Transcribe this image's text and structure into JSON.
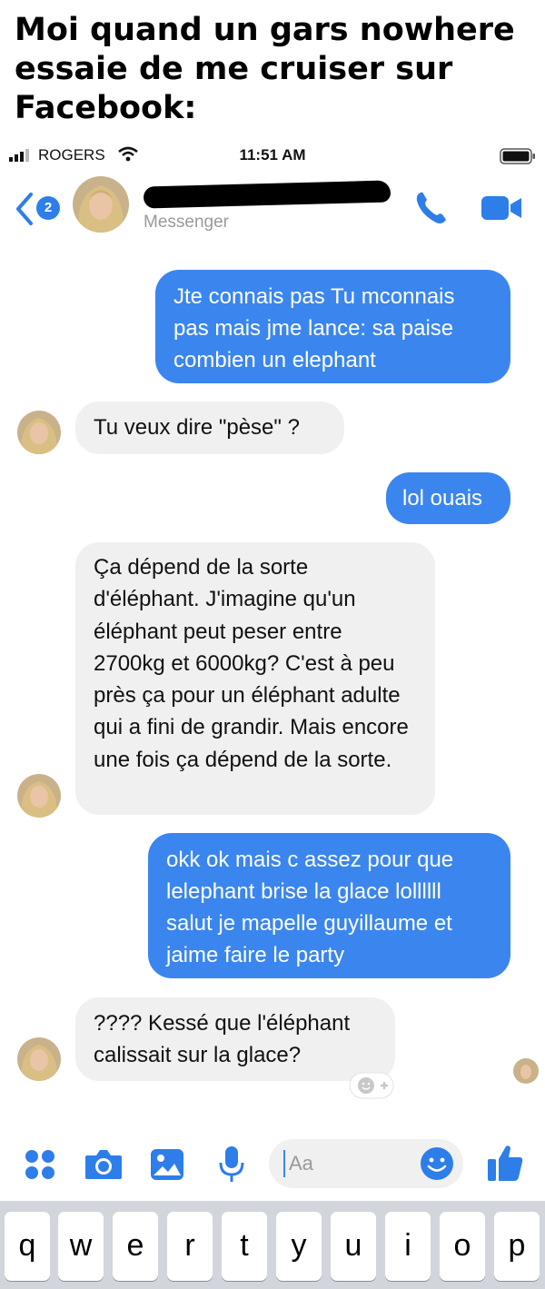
{
  "caption": "Moi quand un gars nowhere essaie de me cruiser sur Facebook:",
  "status_bar": {
    "carrier": "ROGERS",
    "time": "11:51 AM"
  },
  "header": {
    "back_count": "2",
    "subtitle": "Messenger"
  },
  "messages": [
    {
      "from": "me",
      "text": "Jte connais pas Tu mconnais pas mais jme lance: sa paise combien un elephant"
    },
    {
      "from": "them",
      "text": "Tu veux dire \"pèse\" ?"
    },
    {
      "from": "me",
      "text": "lol ouais"
    },
    {
      "from": "them",
      "text": "Ça dépend de la sorte d'éléphant. J'imagine qu'un éléphant peut peser entre 2700kg et 6000kg? C'est à peu près ça pour un éléphant adulte qui a fini de grandir. Mais encore une fois ça dépend de la sorte."
    },
    {
      "from": "me",
      "text": "okk ok mais c assez pour que lelephant brise la glace lollllll salut je mapelle guyillaume et jaime faire le party"
    },
    {
      "from": "them",
      "text": "???? Kessé que l'éléphant calissait sur la glace?"
    }
  ],
  "composer": {
    "placeholder": "Aa"
  },
  "keyboard": {
    "row1": [
      "q",
      "w",
      "e",
      "r",
      "t",
      "y",
      "u",
      "i",
      "o",
      "p"
    ]
  },
  "colors": {
    "accent": "#3b86ee",
    "incoming_bubble": "#f0f0f0"
  },
  "icons": [
    "back-chevron-icon",
    "phone-icon",
    "video-camera-icon",
    "apps-icon",
    "camera-icon",
    "gallery-icon",
    "microphone-icon",
    "emoji-icon",
    "thumbs-up-icon",
    "add-reaction-icon"
  ]
}
